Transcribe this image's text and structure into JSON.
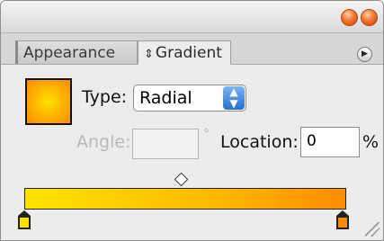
{
  "tabs": {
    "appearance": "Appearance",
    "gradient": "Gradient"
  },
  "type_label": "Type:",
  "type_value": "Radial",
  "angle_label": "Angle:",
  "angle_value": "",
  "degree_symbol": "°",
  "location_label": "Location:",
  "location_value": "0",
  "percent_symbol": "%",
  "colors": {
    "gradient_start": "#ffe200",
    "gradient_end": "#ff8c00",
    "close_button": "#f2762a"
  },
  "icons": {
    "tab_arrows": "up-down-arrows-icon",
    "panel_menu": "panel-menu-icon",
    "select_arrows": "select-arrows-icon"
  }
}
